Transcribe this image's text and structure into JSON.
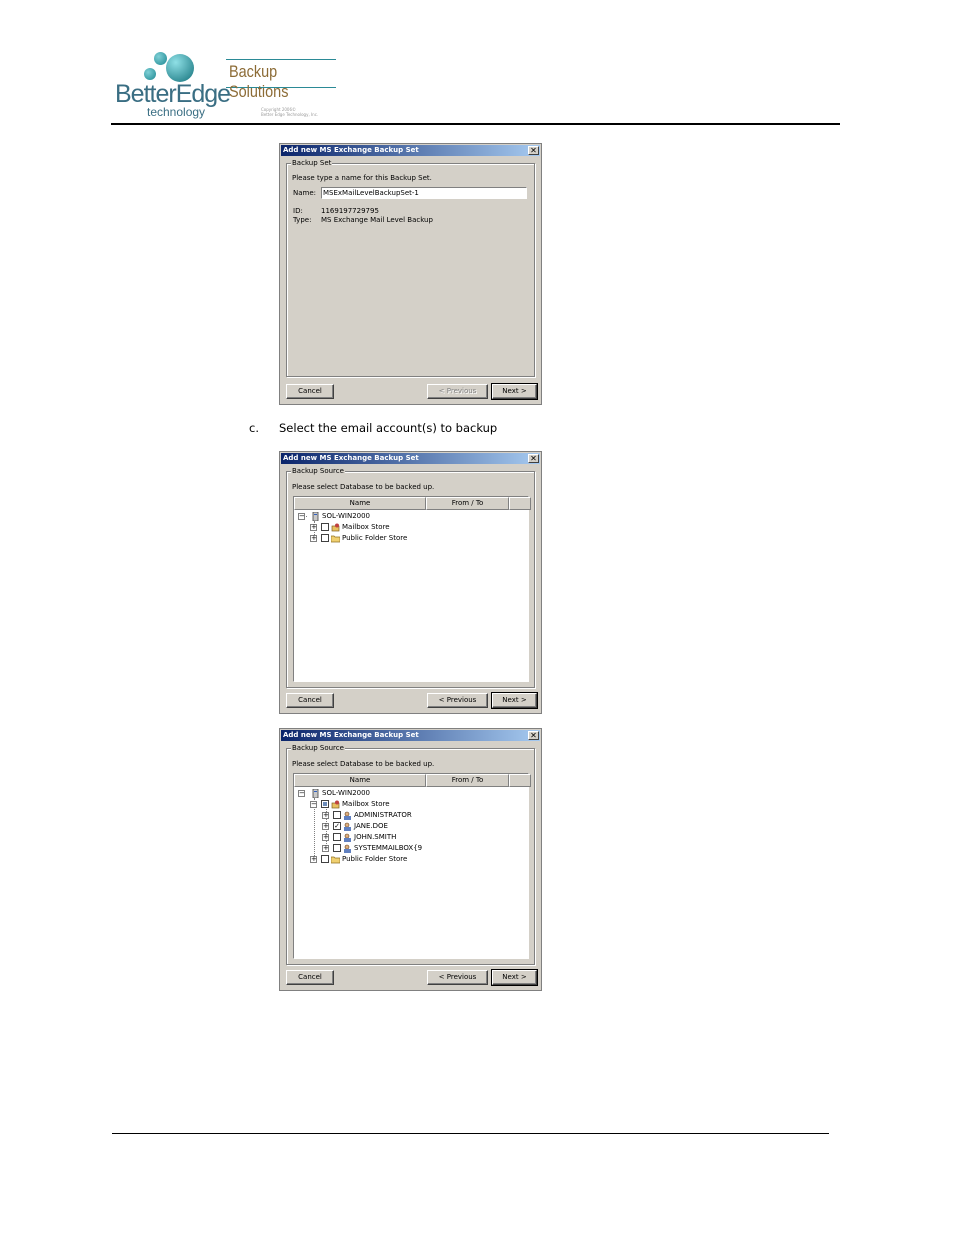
{
  "header": {
    "logo_main": "BetterEdge",
    "logo_sub": "technology",
    "brand": "Backup Solutions",
    "copyright_line1": "Copyright 2006©",
    "copyright_line2": "Better Edge Technology, Inc."
  },
  "step": {
    "letter": "c.",
    "text": "Select the email account(s) to backup"
  },
  "dialog1": {
    "title": "Add new MS Exchange Backup Set",
    "close_glyph": "✕",
    "group_label": "Backup Set",
    "instruction": "Please type a name for this Backup Set.",
    "name_label": "Name:",
    "name_value": "MSExMailLevelBackupSet-1",
    "id_label": "ID:",
    "id_value": "1169197729795",
    "type_label": "Type:",
    "type_value": "MS Exchange Mail Level Backup",
    "cancel": "Cancel",
    "previous": "< Previous",
    "next": "Next >"
  },
  "dialog2": {
    "title": "Add new MS Exchange Backup Set",
    "close_glyph": "✕",
    "group_label": "Backup Source",
    "instruction": "Please select Database to be backed up.",
    "col_name": "Name",
    "col_fromto": "From / To",
    "server": "SOL-WIN2000",
    "mailbox_store": "Mailbox Store",
    "public_folder_store": "Public Folder Store",
    "cancel": "Cancel",
    "previous": "< Previous",
    "next": "Next >"
  },
  "dialog3": {
    "title": "Add new MS Exchange Backup Set",
    "close_glyph": "✕",
    "group_label": "Backup Source",
    "instruction": "Please select Database to be backed up.",
    "col_name": "Name",
    "col_fromto": "From / To",
    "server": "SOL-WIN2000",
    "mailbox_store": "Mailbox Store",
    "mailboxes": [
      {
        "label": "ADMINISTRATOR",
        "checked": false
      },
      {
        "label": "JANE.DOE",
        "checked": true
      },
      {
        "label": "JOHN.SMITH",
        "checked": false
      },
      {
        "label": "SYSTEMMAILBOX{9",
        "checked": false
      }
    ],
    "public_folder_store": "Public Folder Store",
    "cancel": "Cancel",
    "previous": "< Previous",
    "next": "Next >"
  },
  "glyphs": {
    "expand": "+",
    "collapse": "−",
    "check": "✓"
  },
  "colors": {
    "brand_teal": "#2b8a96",
    "brand_gold": "#8c6b35",
    "dialog_bg": "#d4d0c8",
    "titlebar_start": "#0a246a",
    "titlebar_end": "#a6caf0"
  }
}
